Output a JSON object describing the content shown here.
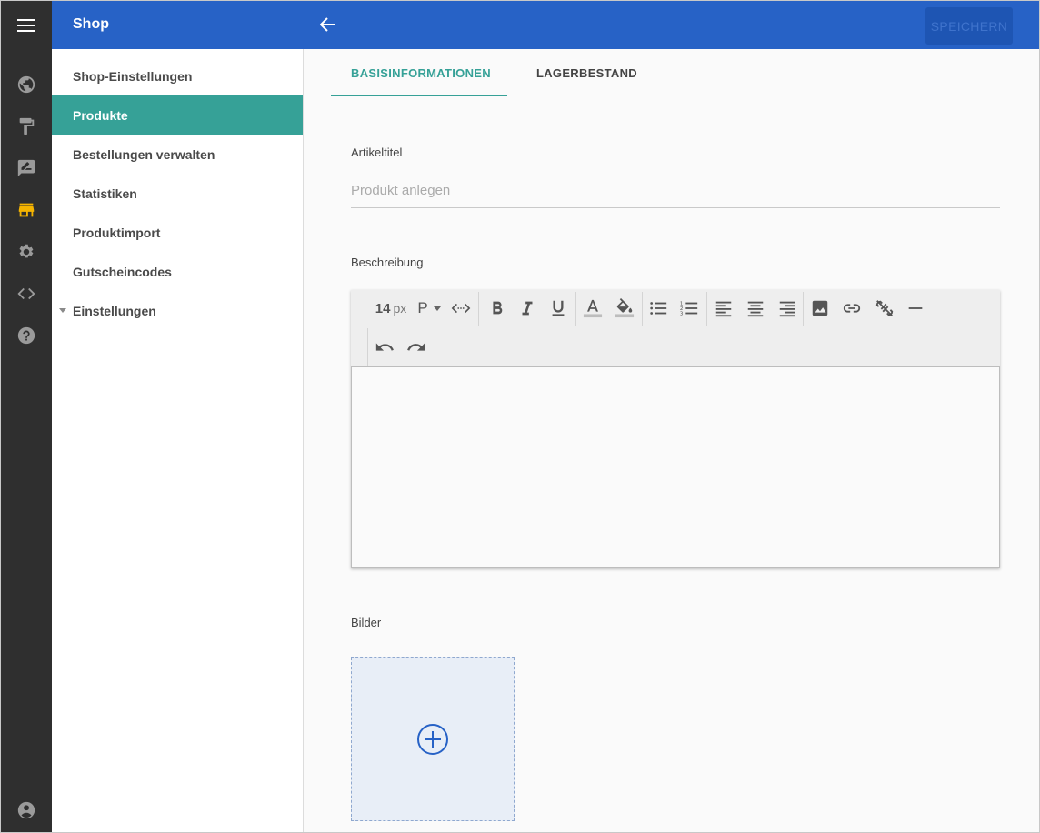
{
  "header": {
    "title": "Shop",
    "save_label": "SPEICHERN"
  },
  "rail": {
    "icons": [
      "menu-icon",
      "globe-icon",
      "paint-roller-icon",
      "rate-review-icon",
      "store-icon",
      "gear-icon",
      "code-icon",
      "help-icon",
      "account-icon"
    ],
    "active": "store-icon",
    "active_color": "#f5b400"
  },
  "sidebar": {
    "items": [
      {
        "label": "Shop-Einstellungen"
      },
      {
        "label": "Produkte",
        "active": true
      },
      {
        "label": "Bestellungen verwalten"
      },
      {
        "label": "Statistiken"
      },
      {
        "label": "Produktimport"
      },
      {
        "label": "Gutscheincodes"
      },
      {
        "label": "Einstellungen",
        "expandable": true
      }
    ]
  },
  "tabs": [
    {
      "label": "BASISINFORMATIONEN",
      "active": true
    },
    {
      "label": "LAGERBESTAND"
    }
  ],
  "form": {
    "title_label": "Artikeltitel",
    "title_placeholder": "Produkt anlegen",
    "title_value": "",
    "description_label": "Beschreibung",
    "images_label": "Bilder"
  },
  "editor": {
    "font_size": "14",
    "font_size_unit": "px",
    "paragraph_label": "P",
    "content": ""
  },
  "colors": {
    "primary": "#2762c6",
    "accent": "#36a197",
    "rail": "#2f2f2f"
  }
}
